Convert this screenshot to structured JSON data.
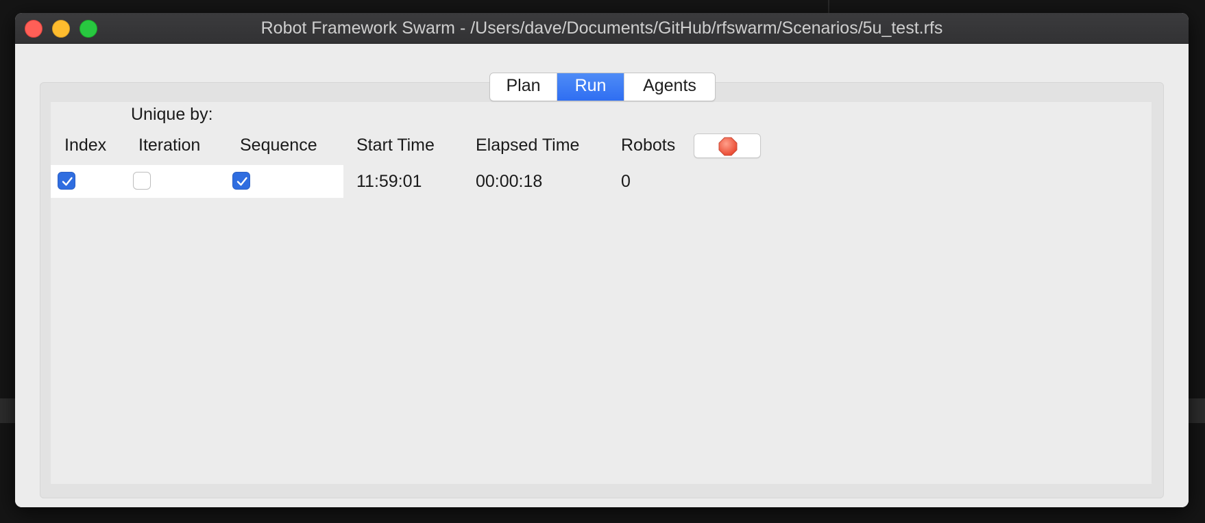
{
  "window": {
    "title": "Robot Framework Swarm - /Users/dave/Documents/GitHub/rfswarm/Scenarios/5u_test.rfs"
  },
  "tabs": [
    {
      "label": "Plan",
      "active": false
    },
    {
      "label": "Run",
      "active": true
    },
    {
      "label": "Agents",
      "active": false
    }
  ],
  "run": {
    "unique_by_label": "Unique by:",
    "columns": {
      "index": "Index",
      "iteration": "Iteration",
      "sequence": "Sequence",
      "start_time": "Start Time",
      "elapsed_time": "Elapsed Time",
      "robots": "Robots"
    },
    "values": {
      "index_checked": true,
      "iteration_checked": false,
      "sequence_checked": true,
      "start_time": "11:59:01",
      "elapsed_time": "00:00:18",
      "robots": "0"
    },
    "stop_button_icon": "stop-icon"
  },
  "colors": {
    "accent": "#2f6ef2",
    "stop": "#f0604a"
  }
}
